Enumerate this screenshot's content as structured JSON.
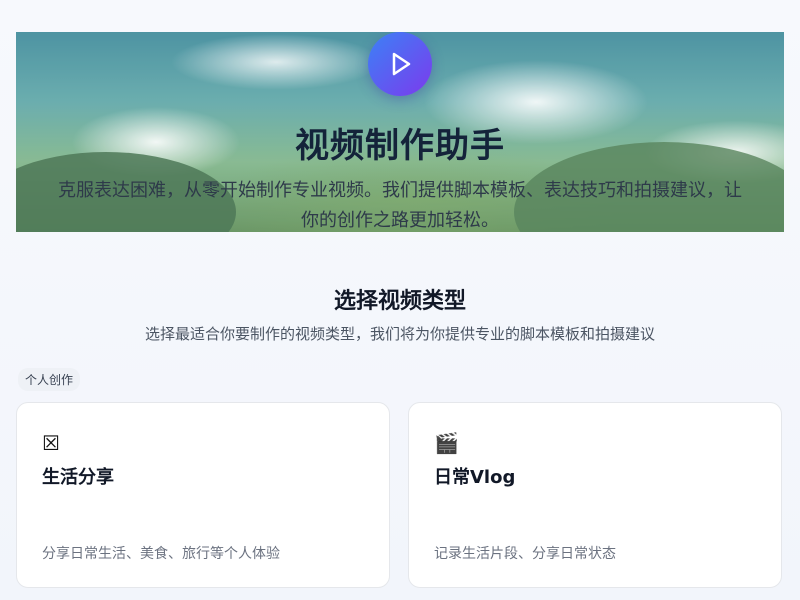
{
  "hero": {
    "icon": "play-icon",
    "title": "视频制作助手",
    "description": "克服表达困难，从零开始制作专业视频。我们提供脚本模板、表达技巧和拍摄建议，让你的创作之路更加轻松。"
  },
  "section": {
    "title": "选择视频类型",
    "subtitle": "选择最适合你要制作的视频类型，我们将为你提供专业的脚本模板和拍摄建议"
  },
  "category": {
    "label": "个人创作"
  },
  "cards": [
    {
      "icon": "missing-emoji-icon",
      "glyph": "☒",
      "title": "生活分享",
      "description": "分享日常生活、美食、旅行等个人体验"
    },
    {
      "icon": "clapperboard-icon",
      "glyph": "🎬",
      "title": "日常Vlog",
      "description": "记录生活片段、分享日常状态"
    }
  ],
  "colors": {
    "accent_start": "#3b82f6",
    "accent_end": "#7c3aed",
    "title_text": "#111827",
    "muted_text": "#6b7280"
  }
}
